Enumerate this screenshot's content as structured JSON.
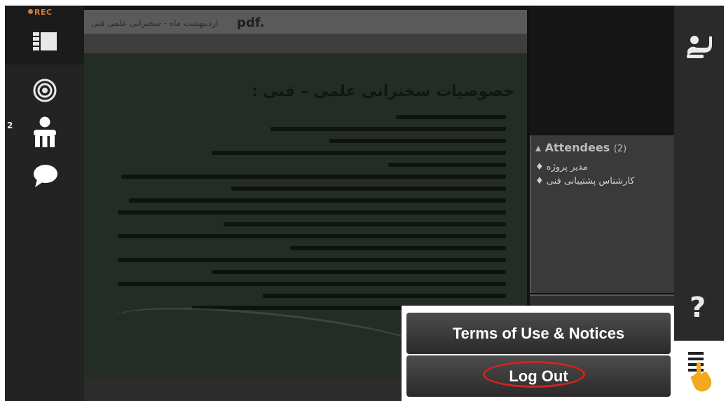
{
  "recording": {
    "label": "REC",
    "color": "#d67a2e"
  },
  "left_toolbar": {
    "tools": [
      {
        "name": "layout-icon"
      },
      {
        "name": "broadcast-icon"
      },
      {
        "name": "attendee-icon"
      },
      {
        "name": "chat-icon"
      }
    ],
    "attendee_badge": "2"
  },
  "document": {
    "title_ext": "pdf.",
    "title_name": "اردیبهشت ماه - سخنرانی علمی فنی",
    "heading": "خصوصیات سخنرانی علمی – فنی :"
  },
  "attendees": {
    "title": "Attendees",
    "count": "(2)",
    "list": [
      "مدیر پروژه ♦",
      "کارشناس پشتیبانی فنی ♦"
    ]
  },
  "right_nav": {
    "help_label": "?",
    "icons": [
      "raise-hand-icon",
      "help-icon",
      "menu-icon"
    ]
  },
  "menu": {
    "terms_label": "Terms of Use & Notices",
    "logout_label": "Log Out",
    "highlight_color": "#d42222"
  }
}
